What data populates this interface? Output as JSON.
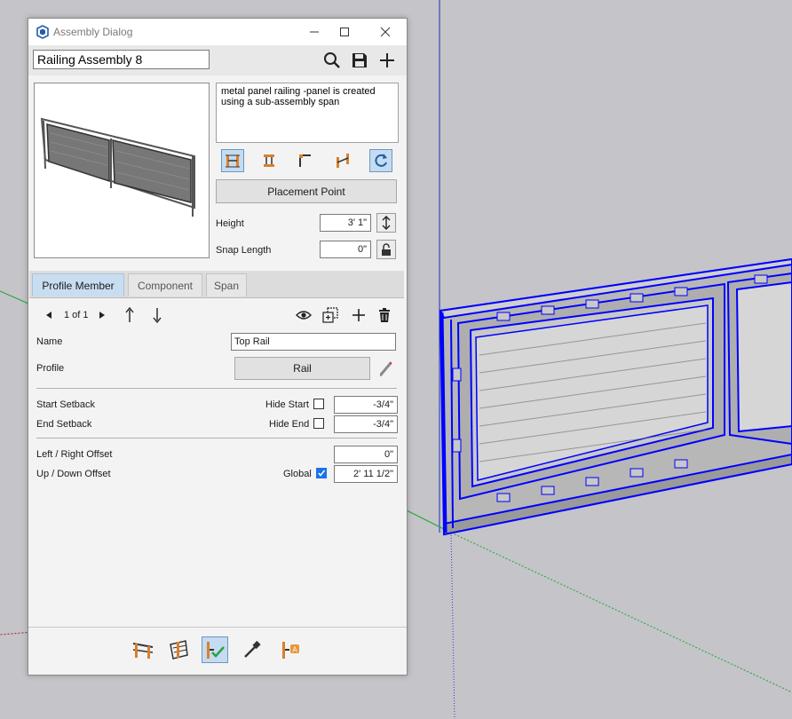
{
  "window": {
    "title": "Assembly Dialog"
  },
  "toolbar": {
    "assembly_name": "Railing Assembly 8"
  },
  "description": "metal panel railing -panel is created using a sub-assembly span",
  "placement": {
    "button_label": "Placement Point"
  },
  "height": {
    "label": "Height",
    "value": "3' 1\""
  },
  "snap": {
    "label": "Snap Length",
    "value": "0\""
  },
  "tabs": [
    {
      "label": "Profile Member",
      "active": true
    },
    {
      "label": "Component",
      "active": false
    },
    {
      "label": "Span",
      "active": false
    }
  ],
  "nav": {
    "page": "1 of 1"
  },
  "member": {
    "name_label": "Name",
    "name_value": "Top Rail",
    "profile_label": "Profile",
    "profile_value": "Rail",
    "start_setback_label": "Start Setback",
    "hide_start_label": "Hide Start",
    "hide_start_checked": false,
    "start_setback_value": "-3/4\"",
    "end_setback_label": "End Setback",
    "hide_end_label": "Hide End",
    "hide_end_checked": false,
    "end_setback_value": "-3/4\"",
    "lr_offset_label": "Left / Right Offset",
    "lr_offset_value": "0\"",
    "ud_offset_label": "Up / Down Offset",
    "global_label": "Global",
    "global_checked": true,
    "ud_offset_value": "2' 11 1/2\""
  },
  "bottom_tools": [
    "railing-icon",
    "railing-angle-icon",
    "railing-check-icon",
    "eyedropper-icon",
    "railing-label-icon"
  ],
  "colors": {
    "accent": "#c5dbf0",
    "selection_blue": "#0000ff",
    "arrow_red": "#b01e1e",
    "icon_orange": "#d9802b"
  }
}
